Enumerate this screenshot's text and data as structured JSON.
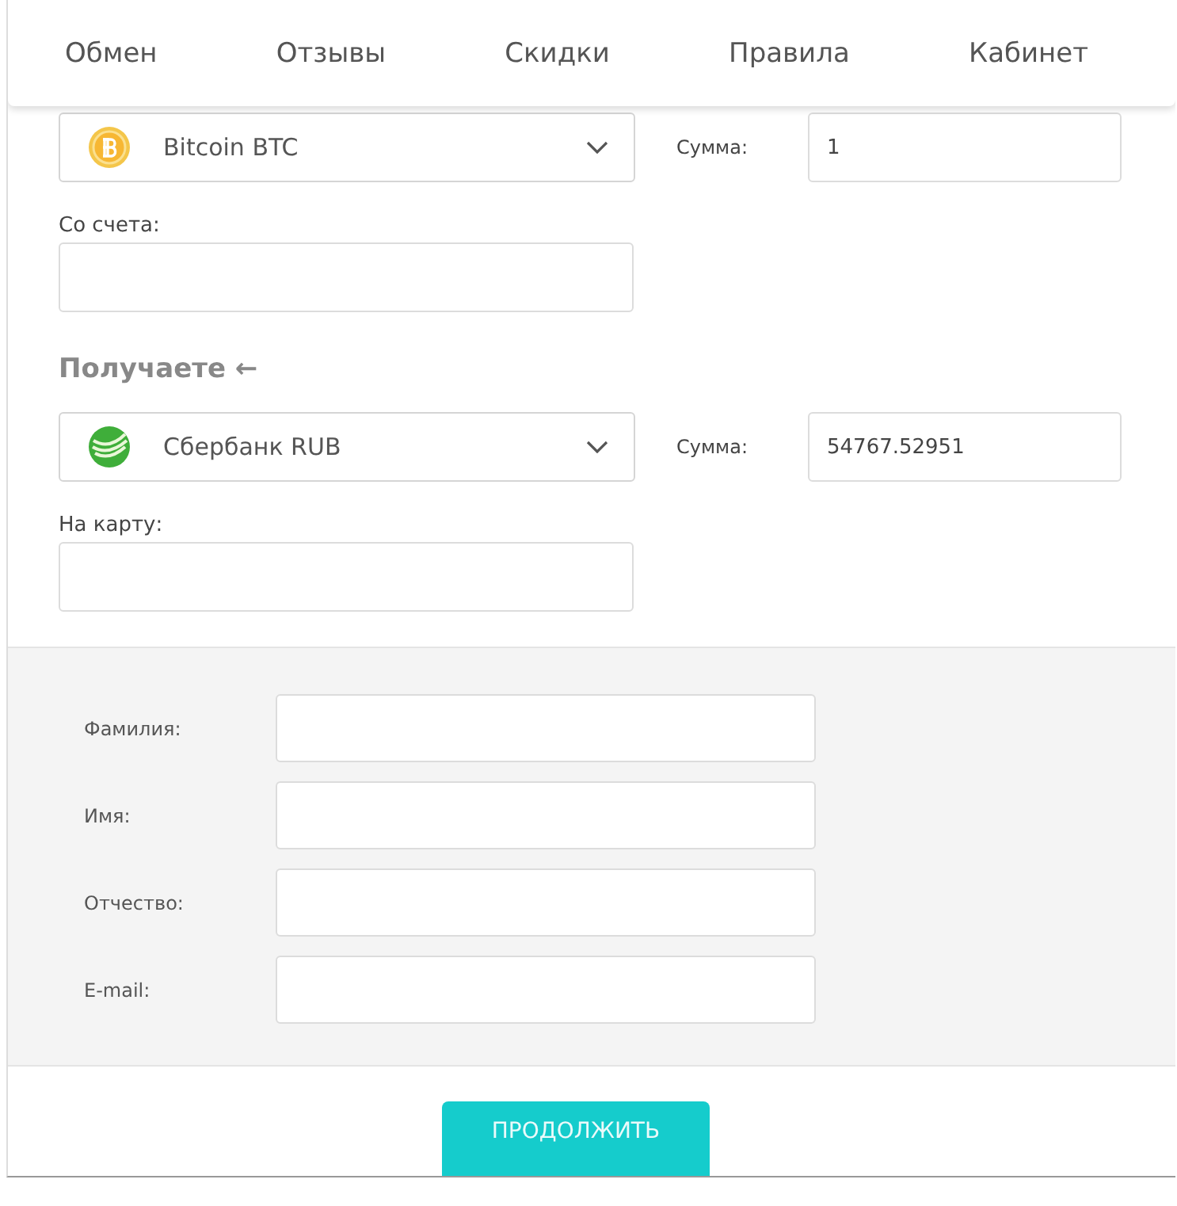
{
  "nav": [
    "Обмен",
    "Отзывы",
    "Скидки",
    "Правила",
    "Кабинет"
  ],
  "send": {
    "currency": {
      "kind": "bitcoin",
      "name": "Bitcoin BTC"
    },
    "amount_label": "Сумма:",
    "amount": "1",
    "account_label": "Со счета:"
  },
  "receive": {
    "heading": "Получаете ←",
    "currency": {
      "kind": "sberbank",
      "name": "Сбербанк RUB"
    },
    "amount_label": "Сумма:",
    "amount": "54767.52951",
    "account_label": "На карту:"
  },
  "personal": [
    {
      "label": "Фамилия:"
    },
    {
      "label": "Имя:"
    },
    {
      "label": "Отчество:"
    },
    {
      "label": "E-mail:"
    }
  ],
  "button": "ПРОДОЛЖИТЬ"
}
